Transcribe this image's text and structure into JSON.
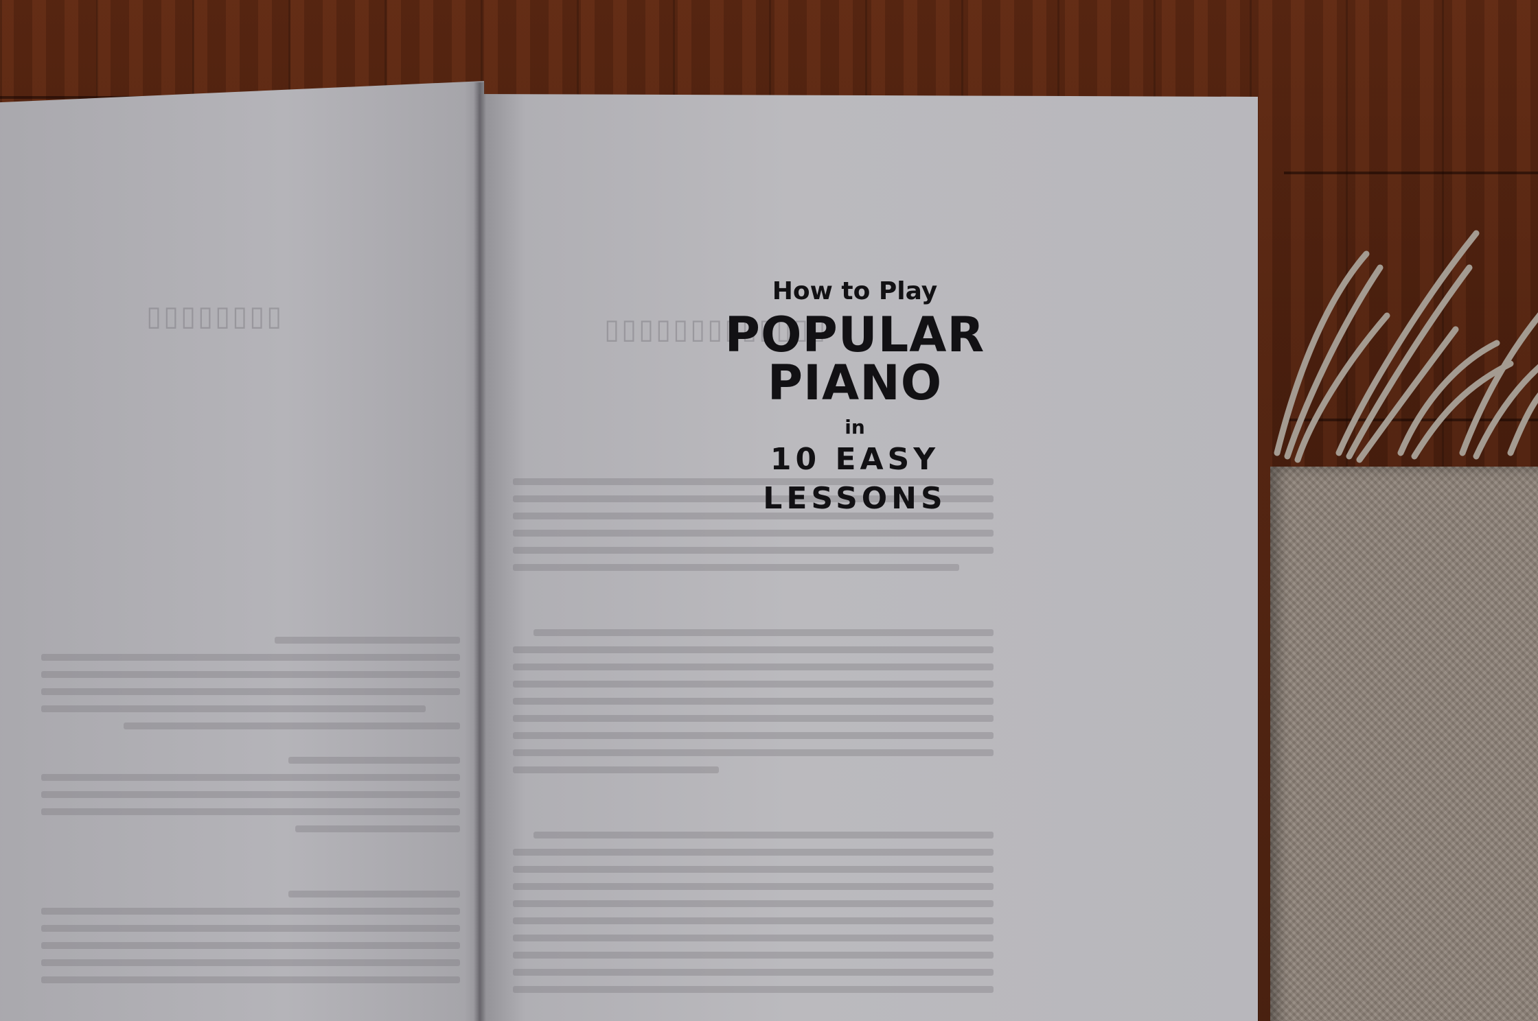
{
  "title_page": {
    "line1": "How to Play",
    "line2": "POPULAR",
    "line3": "PIANO",
    "line4": "in",
    "line5": "10 EASY",
    "line6": "LESSONS"
  },
  "colors": {
    "floor": "#4a1f0e",
    "page": "#b8b7bc",
    "ink": "#121114",
    "rug": "#8d8278"
  }
}
